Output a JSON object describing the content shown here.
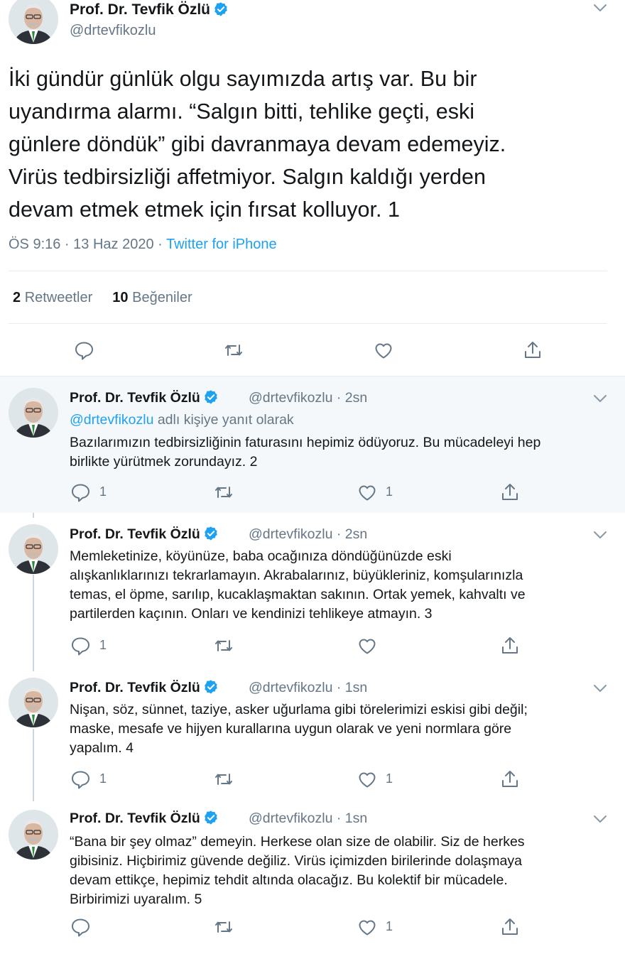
{
  "main_tweet": {
    "author_name": "Prof. Dr. Tevfik Özlü",
    "handle": "@drtevfikozlu",
    "text": "İki gündür günlük olgu sayımızda artış var. Bu bir\nuyandırma alarmı. “Salgın bitti, tehlike geçti, eski\ngünlere döndük” gibi davranmaya devam edemeyiz.\nVirüs tedbirsizliği affetmiyor. Salgın kaldığı yerden\ndevam etmek etmek için fırsat kolluyor. 1",
    "time": "ÖS 9:16 · 13 Haz 2020 · ",
    "source": "Twitter for iPhone",
    "retweets_count": "2",
    "retweets_label": "Retweetler",
    "likes_count": "10",
    "likes_label": "Beğeniler"
  },
  "replies": [
    {
      "author_name": "Prof. Dr. Tevfik Özlü",
      "handle_time": "@drtevfikozlu · 2sn",
      "replying_mention": "@drtevfikozlu",
      "replying_suffix": " adlı kişiye yanıt olarak",
      "text": "Bazılarımızın tedbirsizliğinin faturasını hepimiz ödüyoruz. Bu mücadeleyi hep\nbirlikte yürütmek zorundayız. 2",
      "reply_count": "1",
      "retweet_count": "",
      "like_count": "1"
    },
    {
      "author_name": "Prof. Dr. Tevfik Özlü",
      "handle_time": "@drtevfikozlu · 2sn",
      "text": "Memleketinize, köyünüze, baba ocağınıza döndüğünüzde eski\nalışkanlıklarınızı tekrarlamayın. Akrabalarınız, büyükleriniz, komşularınızla\ntemas, el öpme, sarılıp, kucaklaşmaktan sakının. Ortak yemek, kahvaltı ve\npartilerden kaçının. Onları ve kendinizi tehlikeye atmayın. 3",
      "reply_count": "1",
      "retweet_count": "",
      "like_count": ""
    },
    {
      "author_name": "Prof. Dr. Tevfik Özlü",
      "handle_time": "@drtevfikozlu · 1sn",
      "text": "Nişan, söz, sünnet, taziye, asker uğurlama gibi törelerimizi eskisi gibi değil;\nmaske, mesafe ve hijyen kurallarına uygun olarak ve yeni normlara göre\nyapalım. 4",
      "reply_count": "1",
      "retweet_count": "",
      "like_count": "1"
    },
    {
      "author_name": "Prof. Dr. Tevfik Özlü",
      "handle_time": "@drtevfikozlu · 1sn",
      "text": "“Bana bir şey olmaz” demeyin. Herkese olan size de olabilir. Siz de herkes\ngibisiniz. Hiçbirimiz güvende değiliz. Virüs içimizden birilerinde dolaşmaya\ndevam ettikçe, hepimiz tehdit altında olacağız. Bu kolektif bir mücadele.\nBirbirimizi uyaralım. 5",
      "reply_count": "",
      "retweet_count": "",
      "like_count": "1"
    }
  ],
  "colors": {
    "text": "#14171a",
    "secondary": "#657786",
    "accent": "#1da1f2",
    "highlight_bg": "#f5f8fa",
    "divider": "#e6ecf0"
  },
  "icons": {
    "verified": "verified-badge-icon",
    "caret": "chevron-down-icon",
    "reply": "reply-bubble-icon",
    "retweet": "retweet-icon",
    "like": "heart-icon",
    "share": "share-icon"
  }
}
